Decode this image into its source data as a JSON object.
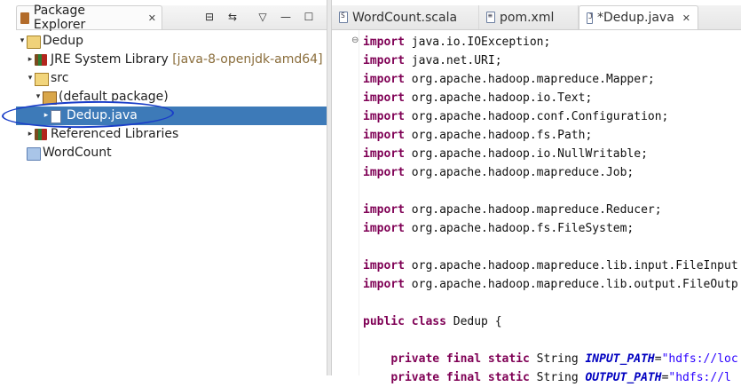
{
  "explorer": {
    "title": "Package Explorer",
    "tree": [
      {
        "label": "Dedup",
        "suffix": "",
        "icon": "project-icon",
        "depth": 0,
        "twisty": "▾"
      },
      {
        "label": "JRE System Library",
        "suffix": "[java-8-openjdk-amd64]",
        "icon": "library-icon",
        "depth": 1,
        "twisty": "▸"
      },
      {
        "label": "src",
        "suffix": "",
        "icon": "source-folder-icon",
        "depth": 1,
        "twisty": "▾"
      },
      {
        "label": "(default package)",
        "suffix": "",
        "icon": "package-icon",
        "depth": 2,
        "twisty": "▾"
      },
      {
        "label": "Dedup.java",
        "suffix": "",
        "icon": "java-file-icon",
        "depth": 3,
        "twisty": "▸",
        "selected": true
      },
      {
        "label": "Referenced Libraries",
        "suffix": "",
        "icon": "library-icon",
        "depth": 1,
        "twisty": "▸"
      },
      {
        "label": "WordCount",
        "suffix": "",
        "icon": "folder-icon",
        "depth": 0,
        "twisty": ""
      }
    ]
  },
  "editor": {
    "tabs": [
      {
        "label": "WordCount.scala",
        "icon_letter": "S",
        "active": false
      },
      {
        "label": "pom.xml",
        "icon_letter": "≡",
        "active": false
      },
      {
        "label": "*Dedup.java",
        "icon_letter": "J",
        "active": true
      }
    ],
    "code": [
      [
        {
          "t": "import",
          "c": "kw"
        },
        {
          "t": " java.io.IOException;",
          "c": ""
        }
      ],
      [
        {
          "t": "import",
          "c": "kw"
        },
        {
          "t": " java.net.URI;",
          "c": ""
        }
      ],
      [
        {
          "t": "import",
          "c": "kw"
        },
        {
          "t": " org.apache.hadoop.mapreduce.Mapper;",
          "c": ""
        }
      ],
      [
        {
          "t": "import",
          "c": "kw"
        },
        {
          "t": " org.apache.hadoop.io.Text;",
          "c": ""
        }
      ],
      [
        {
          "t": "import",
          "c": "kw"
        },
        {
          "t": " org.apache.hadoop.conf.Configuration;",
          "c": ""
        }
      ],
      [
        {
          "t": "import",
          "c": "kw"
        },
        {
          "t": " org.apache.hadoop.fs.Path;",
          "c": ""
        }
      ],
      [
        {
          "t": "import",
          "c": "kw"
        },
        {
          "t": " org.apache.hadoop.io.NullWritable;",
          "c": ""
        }
      ],
      [
        {
          "t": "import",
          "c": "kw"
        },
        {
          "t": " org.apache.hadoop.mapreduce.Job;",
          "c": ""
        }
      ],
      [],
      [
        {
          "t": "import",
          "c": "kw"
        },
        {
          "t": " org.apache.hadoop.mapreduce.Reducer;",
          "c": ""
        }
      ],
      [
        {
          "t": "import",
          "c": "kw"
        },
        {
          "t": " org.apache.hadoop.fs.FileSystem;",
          "c": ""
        }
      ],
      [],
      [
        {
          "t": "import",
          "c": "kw"
        },
        {
          "t": " org.apache.hadoop.mapreduce.lib.input.FileInput",
          "c": ""
        }
      ],
      [
        {
          "t": "import",
          "c": "kw"
        },
        {
          "t": " org.apache.hadoop.mapreduce.lib.output.FileOutp",
          "c": ""
        }
      ],
      [],
      [
        {
          "t": "public class",
          "c": "kw"
        },
        {
          "t": " Dedup {",
          "c": ""
        }
      ],
      [],
      [
        {
          "t": "    ",
          "c": ""
        },
        {
          "t": "private final static",
          "c": "kw"
        },
        {
          "t": " String ",
          "c": ""
        },
        {
          "t": "INPUT_PATH",
          "c": "fld"
        },
        {
          "t": "=",
          "c": ""
        },
        {
          "t": "\"hdfs://loc",
          "c": "str"
        }
      ],
      [
        {
          "t": "    ",
          "c": ""
        },
        {
          "t": "private final static",
          "c": "kw"
        },
        {
          "t": " String ",
          "c": ""
        },
        {
          "t": "OUTPUT_PATH",
          "c": "fld"
        },
        {
          "t": "=",
          "c": ""
        },
        {
          "t": "\"hdfs://l",
          "c": "str"
        }
      ]
    ]
  }
}
